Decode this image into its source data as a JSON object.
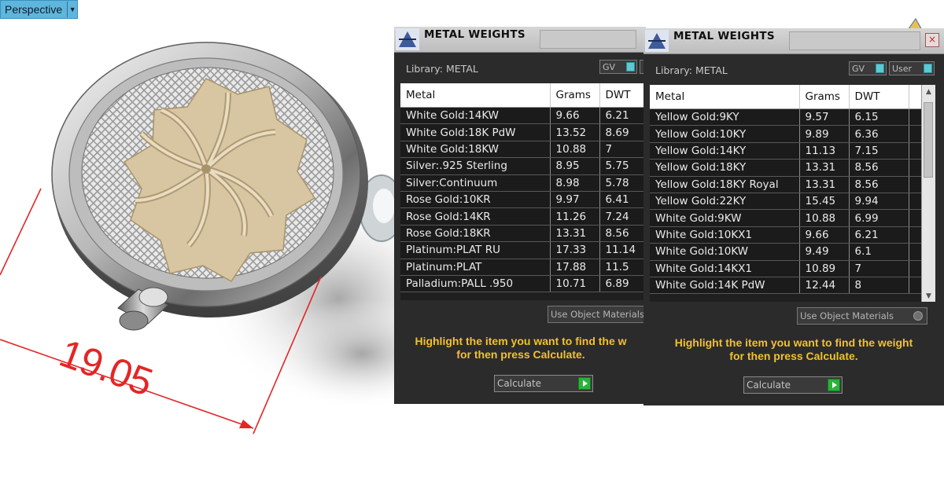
{
  "viewport": {
    "tab_label": "Perspective",
    "dimension_text": "19.05"
  },
  "panels": [
    {
      "title": "METAL WEIGHTS",
      "library_label": "Library: METAL",
      "toggle_gv": "GV",
      "columns": [
        "Metal",
        "Grams",
        "DWT"
      ],
      "rows": [
        [
          "White Gold:14KW",
          "9.66",
          "6.21"
        ],
        [
          "White Gold:18K PdW",
          "13.52",
          "8.69"
        ],
        [
          "White Gold:18KW",
          "10.88",
          "7"
        ],
        [
          "Silver:.925 Sterling",
          "8.95",
          "5.75"
        ],
        [
          "Silver:Continuum",
          "8.98",
          "5.78"
        ],
        [
          "Rose Gold:10KR",
          "9.97",
          "6.41"
        ],
        [
          "Rose Gold:14KR",
          "11.26",
          "7.24"
        ],
        [
          "Rose Gold:18KR",
          "13.31",
          "8.56"
        ],
        [
          "Platinum:PLAT RU",
          "17.33",
          "11.14"
        ],
        [
          "Platinum:PLAT",
          "17.88",
          "11.5"
        ],
        [
          "Palladium:PALL .950",
          "10.71",
          "6.89"
        ]
      ],
      "use_object_materials": "Use Object Materials",
      "hint_line1": "Highlight the item you want to find the w",
      "hint_line2": "for then press Calculate.",
      "calculate_label": "Calculate"
    },
    {
      "title": "METAL WEIGHTS",
      "library_label": "Library: METAL",
      "toggle_gv": "GV",
      "toggle_user": "User",
      "close_label": "×",
      "columns": [
        "Metal",
        "Grams",
        "DWT"
      ],
      "rows": [
        [
          "Yellow Gold:9KY",
          "9.57",
          "6.15"
        ],
        [
          "Yellow Gold:10KY",
          "9.89",
          "6.36"
        ],
        [
          "Yellow Gold:14KY",
          "11.13",
          "7.15"
        ],
        [
          "Yellow Gold:18KY",
          "13.31",
          "8.56"
        ],
        [
          "Yellow Gold:18KY Royal",
          "13.31",
          "8.56"
        ],
        [
          "Yellow Gold:22KY",
          "15.45",
          "9.94"
        ],
        [
          "White Gold:9KW",
          "10.88",
          "6.99"
        ],
        [
          "White Gold:10KX1",
          "9.66",
          "6.21"
        ],
        [
          "White Gold:10KW",
          "9.49",
          "6.1"
        ],
        [
          "White Gold:14KX1",
          "10.89",
          "7"
        ],
        [
          "White Gold:14K PdW",
          "12.44",
          "8"
        ]
      ],
      "use_object_materials": "Use Object Materials",
      "hint_line1": "Highlight the item you want to find the weight",
      "hint_line2": "for then press Calculate.",
      "calculate_label": "Calculate"
    }
  ],
  "colors": {
    "accent_tab": "#5fb6dd",
    "dimension_red": "#e32626",
    "hint_yellow": "#f2c12e",
    "panel_bg": "#2b2b2b",
    "calc_green": "#29b33a"
  }
}
